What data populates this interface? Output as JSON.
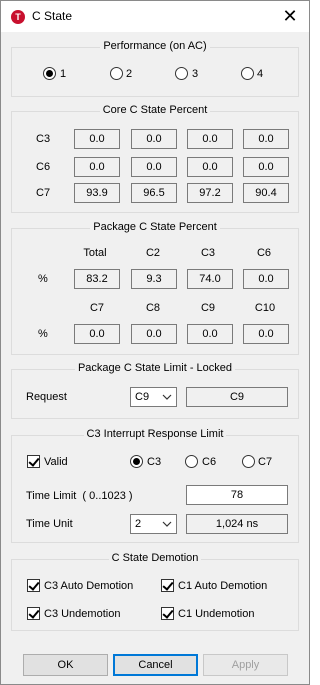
{
  "window": {
    "title": "C State",
    "app_icon_letter": "T",
    "close_glyph": "✕"
  },
  "performance": {
    "title": "Performance (on AC)",
    "options": [
      "1",
      "2",
      "3",
      "4"
    ],
    "selected": "1"
  },
  "core": {
    "title": "Core C State Percent",
    "rows": [
      {
        "label": "C3",
        "values": [
          "0.0",
          "0.0",
          "0.0",
          "0.0"
        ]
      },
      {
        "label": "C6",
        "values": [
          "0.0",
          "0.0",
          "0.0",
          "0.0"
        ]
      },
      {
        "label": "C7",
        "values": [
          "93.9",
          "96.5",
          "97.2",
          "90.4"
        ]
      }
    ]
  },
  "package": {
    "title": "Package C State Percent",
    "row_label": "%",
    "headers1": [
      "Total",
      "C2",
      "C3",
      "C6"
    ],
    "values1": [
      "83.2",
      "9.3",
      "74.0",
      "0.0"
    ],
    "headers2": [
      "C7",
      "C8",
      "C9",
      "C10"
    ],
    "values2": [
      "0.0",
      "0.0",
      "0.0",
      "0.0"
    ]
  },
  "limit": {
    "title": "Package C State Limit - Locked",
    "request_label": "Request",
    "request_value": "C9",
    "current_value": "C9"
  },
  "interrupt": {
    "title": "C3 Interrupt Response Limit",
    "valid_label": "Valid",
    "valid_checked": true,
    "options": [
      "C3",
      "C6",
      "C7"
    ],
    "selected": "C3",
    "time_limit_label": "Time Limit  ( 0..1023 )",
    "time_limit_value": "78",
    "time_unit_label": "Time Unit",
    "time_unit_value": "2",
    "time_unit_display": "1,024 ns"
  },
  "demotion": {
    "title": "C State Demotion",
    "items": [
      {
        "label": "C3 Auto Demotion",
        "checked": true
      },
      {
        "label": "C1 Auto Demotion",
        "checked": true
      },
      {
        "label": "C3 Undemotion",
        "checked": true
      },
      {
        "label": "C1 Undemotion",
        "checked": true
      }
    ]
  },
  "buttons": {
    "ok": "OK",
    "cancel": "Cancel",
    "apply": "Apply"
  }
}
